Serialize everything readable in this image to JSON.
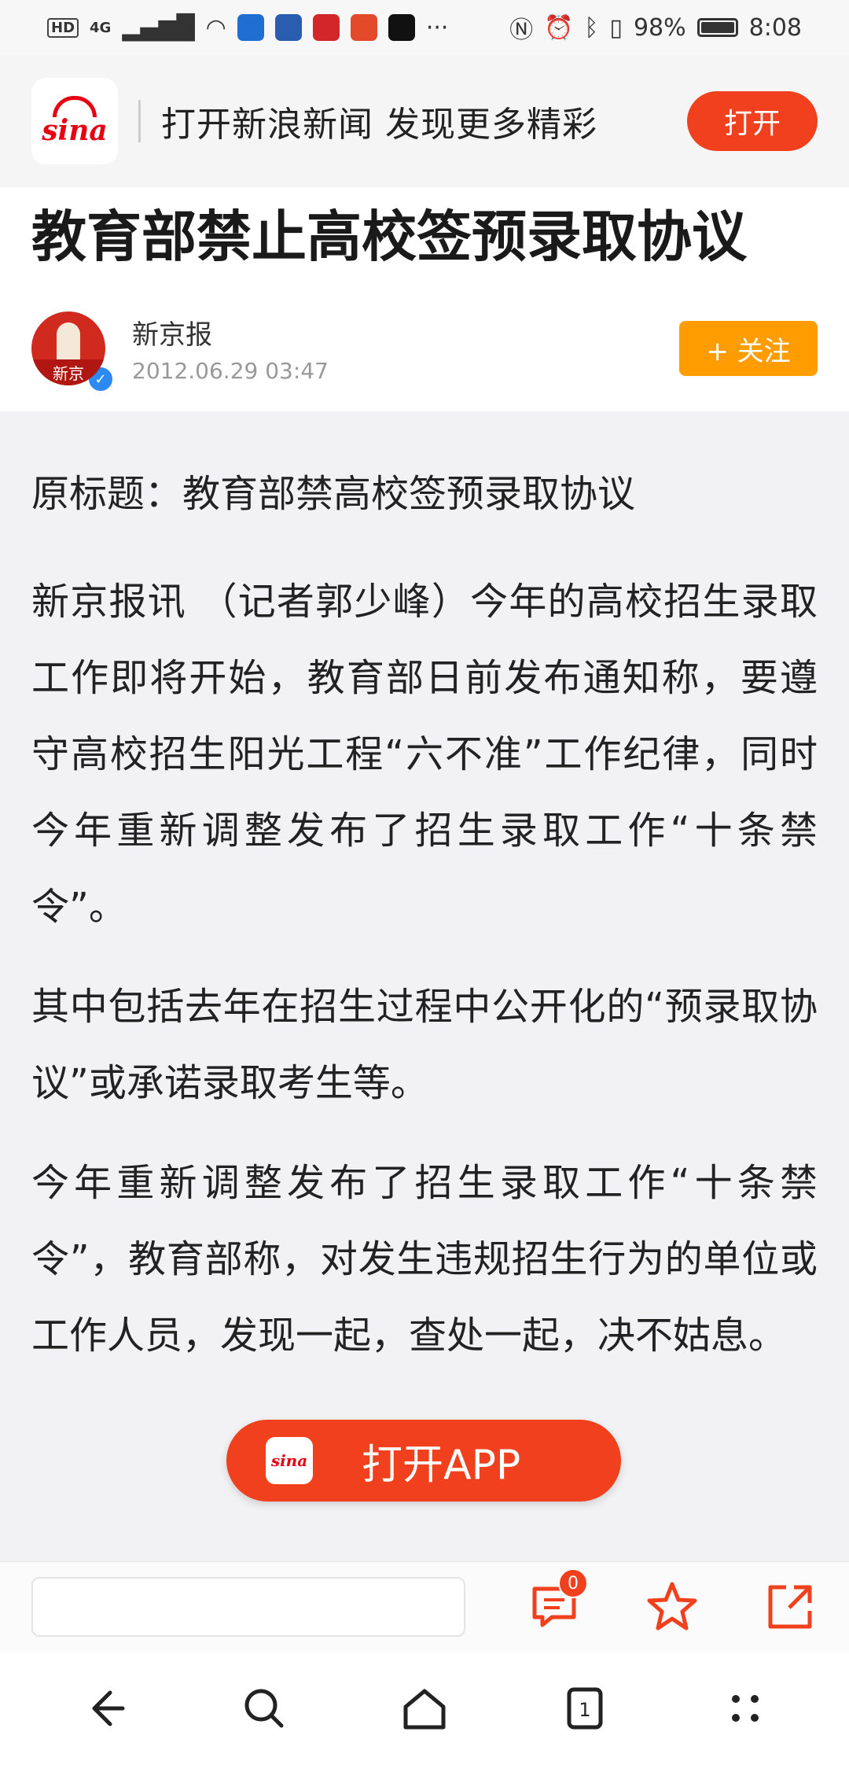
{
  "status_bar": {
    "network_badge": "HD",
    "signal": "4G",
    "battery": "98%",
    "time": "8:08",
    "more_indicator": "···"
  },
  "banner": {
    "logo_text": "sina",
    "text": "打开新浪新闻 发现更多精彩",
    "open_label": "打开"
  },
  "article": {
    "title": "教育部禁止高校签预录取协议",
    "author": {
      "name": "新京报",
      "avatar_text": "新京",
      "time": "2012.06.29 03:47"
    },
    "follow_label": "+ 关注",
    "paragraphs": [
      "原标题：教育部禁高校签预录取协议",
      "新京报讯 （记者郭少峰）今年的高校招生录取工作即将开始，教育部日前发布通知称，要遵守高校招生阳光工程“六不准”工作纪律，同时今年重新调整发布了招生录取工作“十条禁令”。",
      "其中包括去年在招生过程中公开化的“预录取协议”或承诺录取考生等。",
      "今年重新调整发布了招生录取工作“十条禁令”，教育部称，对发生违规招生行为的单位或工作人员，发现一起，查处一起，决不姑息。"
    ]
  },
  "float_button": {
    "logo_text": "sina",
    "label": "打开APP"
  },
  "comment_bar": {
    "comment_count": "0"
  },
  "colors": {
    "accent": "#f0401e",
    "follow": "#ff9c00",
    "brand_red": "#e60012"
  }
}
